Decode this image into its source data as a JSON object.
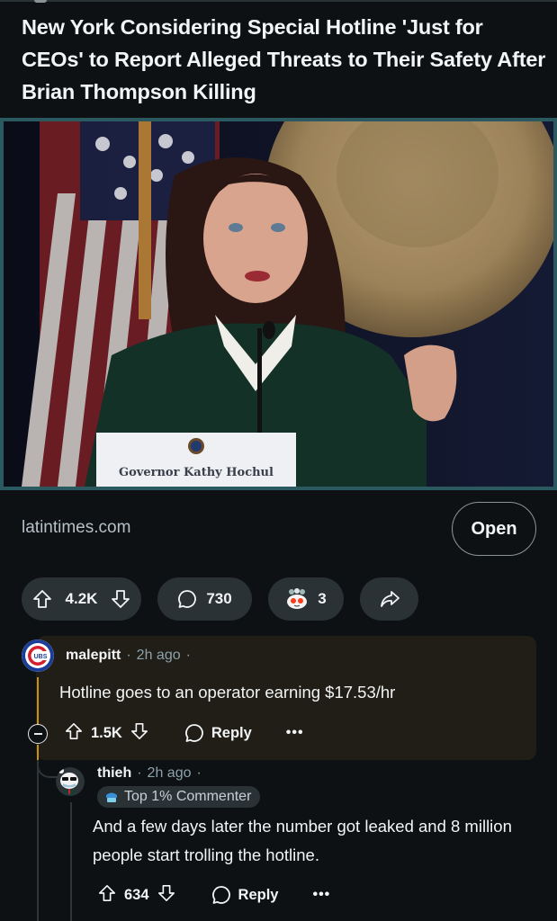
{
  "post": {
    "title": "New York Considering Special Hotline 'Just for CEOs' to Report Alleged Threats to Their Safety After Brian Thompson Killing",
    "image_alt": "Governor Kathy Hochul speaking at a press conference",
    "image_caption_placard": "Governor Kathy Hochul",
    "link_domain": "latintimes.com",
    "open_label": "Open"
  },
  "actions": {
    "upvote_icon": "arrow-up-icon",
    "score": "4.2K",
    "downvote_icon": "arrow-down-icon",
    "comments_icon": "speech-bubble-icon",
    "comment_count": "730",
    "awards_icon": "snoo-award-icon",
    "award_count": "3",
    "share_icon": "share-arrow-icon"
  },
  "comments": [
    {
      "username": "malepitt",
      "time": "2h ago",
      "avatar": "cubs-logo-avatar",
      "body": "Hotline goes to an operator earning $17.53/hr",
      "score": "1.5K",
      "reply_label": "Reply",
      "more_label": "•••",
      "highlighted": true,
      "accent_color": "#c7920c"
    },
    {
      "username": "thieh",
      "time": "2h ago",
      "avatar": "panda-sunglasses-avatar",
      "flair": "Top 1% Commenter",
      "body": "And a few days later the number got leaked and 8 million people start trolling the hotline.",
      "score": "634",
      "reply_label": "Reply",
      "more_label": "•••"
    }
  ],
  "separator": "·",
  "colors": {
    "background": "#0e1113",
    "pill": "#2a3236",
    "media_border": "#2a5a60",
    "highlight": "#201e16",
    "meta_text": "#8ba2ad"
  }
}
